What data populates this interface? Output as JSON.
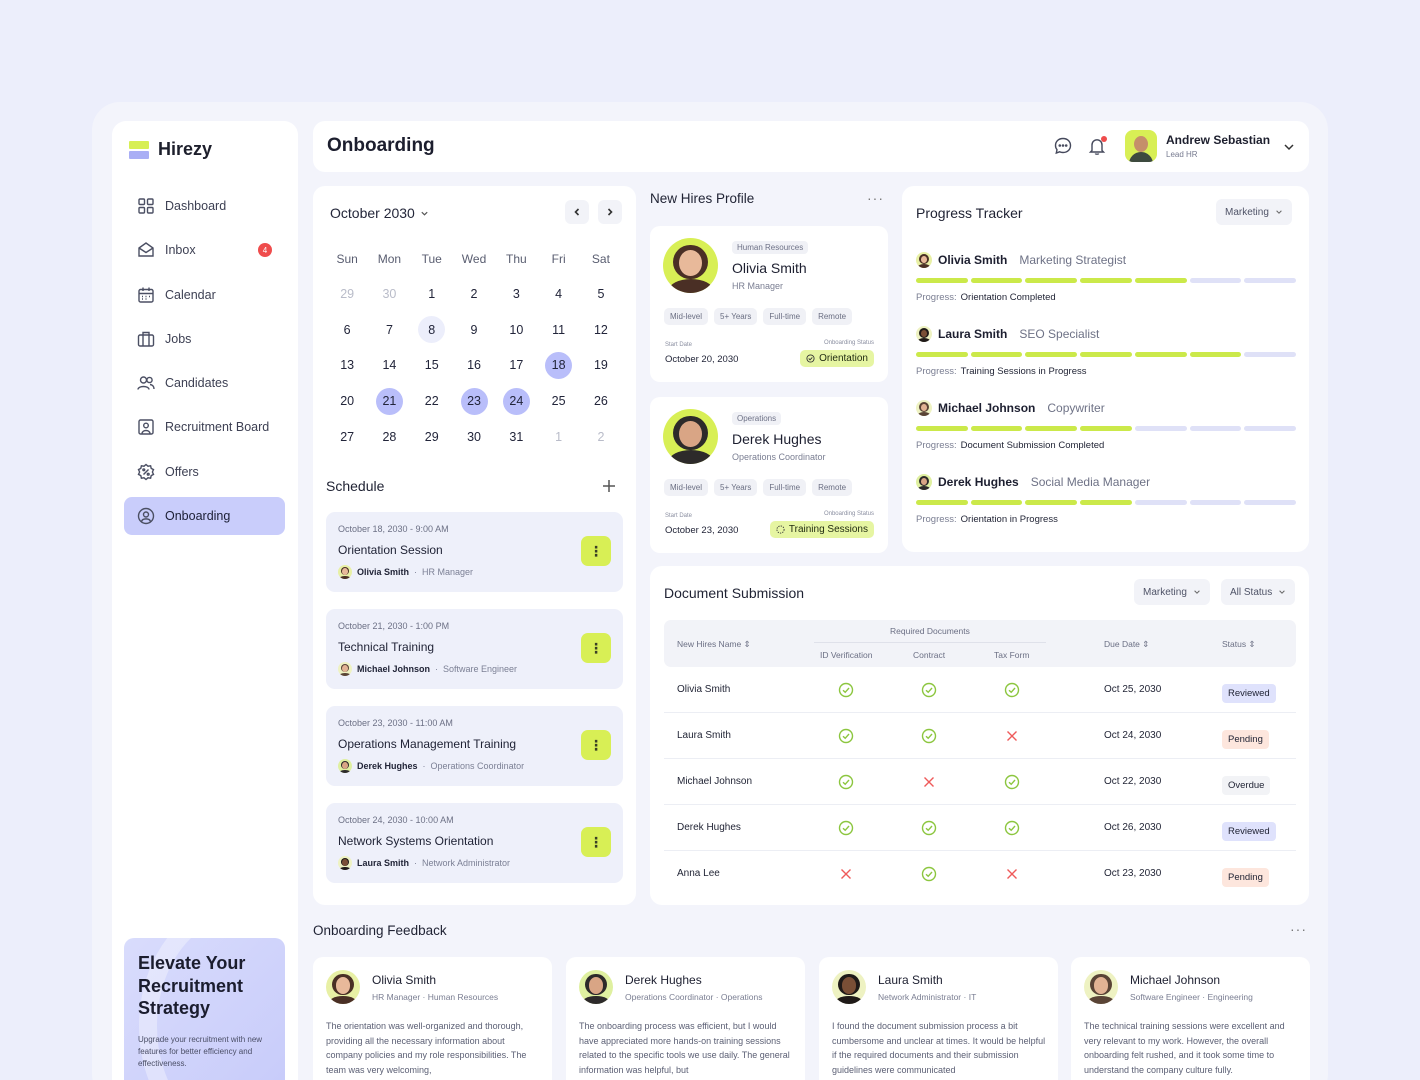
{
  "app": {
    "name": "Hirezy"
  },
  "sidebar": {
    "items": [
      {
        "label": "Dashboard",
        "icon": "grid-icon"
      },
      {
        "label": "Inbox",
        "icon": "mail-icon",
        "badge": "4"
      },
      {
        "label": "Calendar",
        "icon": "calendar-icon"
      },
      {
        "label": "Jobs",
        "icon": "briefcase-icon"
      },
      {
        "label": "Candidates",
        "icon": "users-icon"
      },
      {
        "label": "Recruitment Board",
        "icon": "board-icon"
      },
      {
        "label": "Offers",
        "icon": "offer-icon"
      },
      {
        "label": "Onboarding",
        "icon": "onboarding-icon",
        "active": true
      }
    ],
    "promo": {
      "title": "Elevate Your Recruitment Strategy",
      "subtitle": "Upgrade your recruitment with new features for better efficiency and effectiveness."
    }
  },
  "header": {
    "title": "Onboarding",
    "user": {
      "name": "Andrew Sebastian",
      "role": "Lead HR"
    }
  },
  "calendar": {
    "month": "October 2030",
    "weekdays": [
      "Sun",
      "Mon",
      "Tue",
      "Wed",
      "Thu",
      "Fri",
      "Sat"
    ],
    "days": [
      [
        "29",
        "30",
        "1",
        "2",
        "3",
        "4",
        "5"
      ],
      [
        "6",
        "7",
        "8",
        "9",
        "10",
        "11",
        "12"
      ],
      [
        "13",
        "14",
        "15",
        "16",
        "17",
        "18",
        "19"
      ],
      [
        "20",
        "21",
        "22",
        "23",
        "24",
        "25",
        "26"
      ],
      [
        "27",
        "28",
        "29",
        "30",
        "31",
        "1",
        "2"
      ]
    ]
  },
  "schedule": {
    "title": "Schedule",
    "items": [
      {
        "date": "October 18, 2030 - 9:00 AM",
        "name": "Orientation Session",
        "person": "Olivia Smith",
        "role": "HR Manager"
      },
      {
        "date": "October 21, 2030 - 1:00 PM",
        "name": "Technical Training",
        "person": "Michael Johnson",
        "role": "Software Engineer"
      },
      {
        "date": "October 23, 2030 - 11:00 AM",
        "name": "Operations Management Training",
        "person": "Derek Hughes",
        "role": "Operations Coordinator"
      },
      {
        "date": "October 24, 2030 - 10:00 AM",
        "name": "Network Systems Orientation",
        "person": "Laura Smith",
        "role": "Network Administrator"
      }
    ]
  },
  "new_hires": {
    "title": "New Hires Profile",
    "cards": [
      {
        "dept": "Human Resources",
        "name": "Olivia Smith",
        "role": "HR Manager",
        "tags": [
          "Mid-level",
          "5+ Years",
          "Full-time",
          "Remote"
        ],
        "start_label": "Start Date",
        "start": "October 20, 2030",
        "status_label": "Onboarding Status",
        "status": "Orientation"
      },
      {
        "dept": "Operations",
        "name": "Derek Hughes",
        "role": "Operations Coordinator",
        "tags": [
          "Mid-level",
          "5+ Years",
          "Full-time",
          "Remote"
        ],
        "start_label": "Start Date",
        "start": "October 23, 2030",
        "status_label": "Onboarding Status",
        "status": "Training Sessions"
      }
    ]
  },
  "progress": {
    "title": "Progress Tracker",
    "filter": "Marketing",
    "progress_label": "Progress:",
    "rows": [
      {
        "name": "Olivia Smith",
        "role": "Marketing Strategist",
        "status": "Orientation Completed",
        "filled": 5,
        "total": 7
      },
      {
        "name": "Laura Smith",
        "role": "SEO Specialist",
        "status": "Training Sessions in Progress",
        "filled": 6,
        "total": 7
      },
      {
        "name": "Michael Johnson",
        "role": "Copywriter",
        "status": "Document Submission Completed",
        "filled": 4,
        "total": 7
      },
      {
        "name": "Derek Hughes",
        "role": "Social Media Manager",
        "status": "Orientation in Progress",
        "filled": 4,
        "total": 7
      }
    ]
  },
  "documents": {
    "title": "Document Submission",
    "filter_dept": "Marketing",
    "filter_status": "All Status",
    "headers": {
      "name": "New Hires Name",
      "group": "Required Documents",
      "id": "ID Verification",
      "contract": "Contract",
      "tax": "Tax Form",
      "due": "Due Date",
      "status": "Status"
    },
    "rows": [
      {
        "name": "Olivia Smith",
        "id": true,
        "contract": true,
        "tax": true,
        "due": "Oct 25, 2030",
        "status": "Reviewed"
      },
      {
        "name": "Laura Smith",
        "id": true,
        "contract": true,
        "tax": false,
        "due": "Oct 24, 2030",
        "status": "Pending"
      },
      {
        "name": "Michael Johnson",
        "id": true,
        "contract": false,
        "tax": true,
        "due": "Oct 22, 2030",
        "status": "Overdue"
      },
      {
        "name": "Derek Hughes",
        "id": true,
        "contract": true,
        "tax": true,
        "due": "Oct 26, 2030",
        "status": "Reviewed"
      },
      {
        "name": "Anna Lee",
        "id": false,
        "contract": true,
        "tax": false,
        "due": "Oct 23, 2030",
        "status": "Pending"
      }
    ],
    "status_colors": {
      "Reviewed": "#dfe2fc",
      "Pending": "#fde6dd",
      "Overdue": "#f2f3f6"
    }
  },
  "feedback": {
    "title": "Onboarding Feedback",
    "cards": [
      {
        "name": "Olivia Smith",
        "role": "HR Manager",
        "dept": "Human Resources",
        "text": "The orientation was well-organized and thorough, providing all the necessary information about company policies and my role responsibilities. The team was very welcoming,"
      },
      {
        "name": "Derek Hughes",
        "role": "Operations Coordinator",
        "dept": "Operations",
        "text": "The onboarding process was efficient, but I would have appreciated more hands-on training sessions related to the specific tools we use daily. The general information was helpful, but"
      },
      {
        "name": "Laura Smith",
        "role": "Network Administrator",
        "dept": "IT",
        "text": "I found the document submission process a bit cumbersome and unclear at times. It would be helpful if the required documents and their submission guidelines were communicated"
      },
      {
        "name": "Michael Johnson",
        "role": "Software Engineer",
        "dept": "Engineering",
        "text": "The technical training sessions were excellent and very relevant to my work. However, the overall onboarding felt rushed, and it took some time to understand the company culture fully."
      }
    ]
  },
  "colors": {
    "accent_lime": "#d8ef55",
    "accent_lavender": "#b9befa",
    "check": "#8cc63f",
    "cross": "#ef5a5a"
  }
}
